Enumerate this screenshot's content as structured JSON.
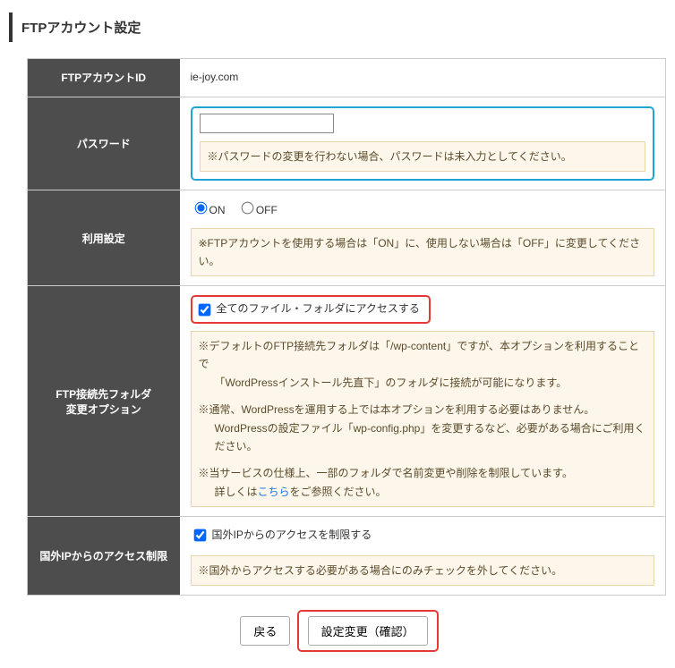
{
  "page_title": "FTPアカウント設定",
  "rows": {
    "account_id": {
      "label": "FTPアカウントID",
      "value": "ie-joy.com"
    },
    "password": {
      "label": "パスワード",
      "note": "※パスワードの変更を行わない場合、パスワードは未入力としてください。"
    },
    "usage": {
      "label": "利用設定",
      "on": "ON",
      "off": "OFF",
      "note": "※FTPアカウントを使用する場合は「ON」に、使用しない場合は「OFF」に変更してください。"
    },
    "folder_option": {
      "label": "FTP接続先フォルダ\n変更オプション",
      "checkbox": "全てのファイル・フォルダにアクセスする",
      "note1_a": "※デフォルトのFTP接続先フォルダは「/wp-content」ですが、本オプションを利用することで",
      "note1_b": "「WordPressインストール先直下」のフォルダに接続が可能になります。",
      "note2_a": "※通常、WordPressを運用する上では本オプションを利用する必要はありません。",
      "note2_b": "WordPressの設定ファイル「wp-config.php」を変更するなど、必要がある場合にご利用ください。",
      "note3_a": "※当サービスの仕様上、一部のフォルダで名前変更や削除を制限しています。",
      "note3_b_pre": "詳しくは",
      "note3_link": "こちら",
      "note3_b_post": "をご参照ください。"
    },
    "overseas_ip": {
      "label": "国外IPからのアクセス制限",
      "checkbox": "国外IPからのアクセスを制限する",
      "note": "※国外からアクセスする必要がある場合にのみチェックを外してください。"
    }
  },
  "buttons": {
    "back": "戻る",
    "submit": "設定変更（確認）"
  }
}
